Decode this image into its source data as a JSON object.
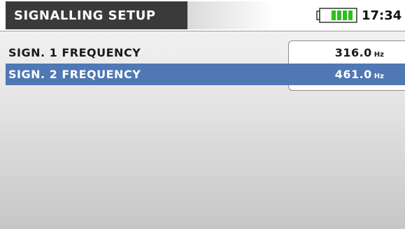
{
  "header": {
    "title": "SIGNALLING SETUP",
    "clock": "17:34",
    "battery_icon": "battery-full-icon",
    "battery_color": "#2fbf1f"
  },
  "settings": [
    {
      "label": "SIGN. 1 FREQUENCY",
      "value": "316.0",
      "unit": "Hz",
      "selected": false
    },
    {
      "label": "SIGN. 2 FREQUENCY",
      "value": "461.0",
      "unit": "Hz",
      "selected": true
    }
  ],
  "colors": {
    "title_bg": "#3a3a3a",
    "selection": "#4f78b5"
  }
}
